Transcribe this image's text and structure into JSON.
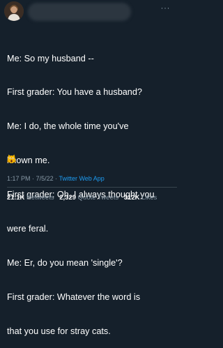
{
  "tweet": {
    "more_label": "···",
    "lines": [
      "Me: So my husband --",
      "First grader: You have a husband?",
      "Me: I do, the whole time you've",
      "known me.",
      "First grader: Oh. I always thought you",
      "were feral.",
      "Me: Er, do you mean 'single'?",
      "First grader: Whatever the word is",
      "that you use for stray cats."
    ],
    "emoji": "scream-cat-emoji",
    "time": "1:17 PM",
    "date": "7/5/22",
    "separator": "·",
    "source": "Twitter Web App"
  },
  "stats": {
    "retweets_count": "21.1K",
    "retweets_label": "Retweets",
    "quotes_count": "2,329",
    "quotes_label": "Quote Tweets",
    "likes_count": "312K",
    "likes_label": "Likes"
  },
  "colors": {
    "background": "#15202b",
    "text": "#ffffff",
    "muted": "#8899a6",
    "link": "#1d9bf0",
    "divider": "#38444d"
  }
}
